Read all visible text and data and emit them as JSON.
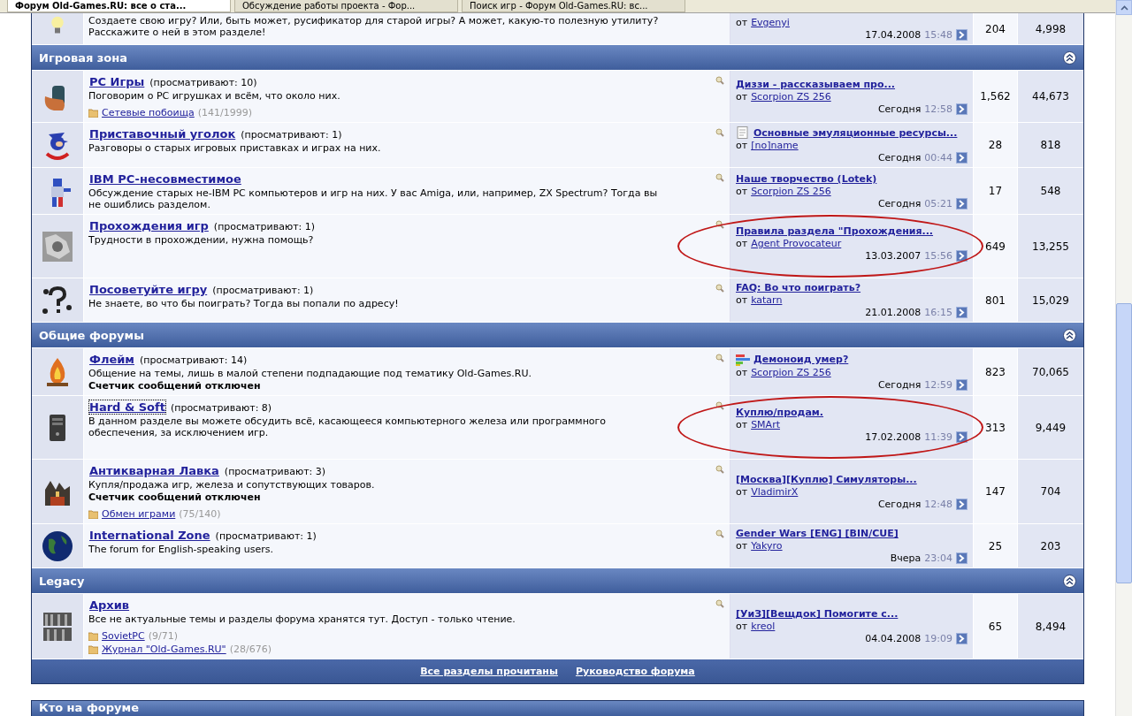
{
  "browser_tabs": [
    {
      "title": "Форум Old-Games.RU: все о ста...",
      "selected": true
    },
    {
      "title": "Обсуждение работы проекта - Фор...",
      "selected": false
    },
    {
      "title": "Поиск игр - Форум Old-Games.RU: вс...",
      "selected": false
    }
  ],
  "partial_row": {
    "description": "Создаете свою игру? Или, быть может, русификатор для старой игры? А может, какую-то полезную утилиту? Расскажите о ней в этом разделе!",
    "last_post": {
      "by": "от",
      "author": "Evgenyi",
      "date": "17.04.2008",
      "time": "15:48"
    },
    "threads": "204",
    "posts": "4,998"
  },
  "categories": [
    {
      "title": "Игровая зона",
      "expanded": true,
      "forums": [
        {
          "title": "PC Игры",
          "viewers": "(просматривают: 10)",
          "focused": false,
          "circled": false,
          "description": "Поговорим о PC игрушках и всём, что около них.",
          "subforums": [
            {
              "name": "Сетевые побоища",
              "count": "(141/1999)"
            }
          ],
          "last_post": {
            "title": "Диззи - рассказываем про...",
            "by": "от",
            "author": "Scorpion ZS 256",
            "date": "Сегодня",
            "time": "12:58"
          },
          "threads": "1,562",
          "posts": "44,673"
        },
        {
          "title": "Приставочный уголок",
          "viewers": "(просматривают: 1)",
          "focused": false,
          "circled": false,
          "description": "Разговоры о старых игровых приставках и играх на них.",
          "last_post": {
            "kind": "document",
            "title": "Основные эмуляционные ресурсы...",
            "by": "от",
            "author": "[no]name",
            "date": "Сегодня",
            "time": "00:44"
          },
          "threads": "28",
          "posts": "818"
        },
        {
          "title": "IBM PC-несовместимое",
          "focused": false,
          "circled": false,
          "description": "Обсуждение старых не-IBM PC компьютеров и игр на них. У вас Amiga, или, например, ZX Spectrum? Тогда вы не ошиблись разделом.",
          "last_post": {
            "title": "Наше творчество (Lotek)",
            "by": "от",
            "author": "Scorpion ZS 256",
            "date": "Сегодня",
            "time": "05:21"
          },
          "threads": "17",
          "posts": "548"
        },
        {
          "title": "Прохождения игр",
          "viewers": "(просматривают: 1)",
          "focused": false,
          "circled": true,
          "description": "Трудности в прохождении, нужна помощь?",
          "last_post": {
            "title": "Правила раздела \"Прохождения...",
            "by": "от",
            "author": "Agent Provocateur",
            "date": "13.03.2007",
            "time": "15:56"
          },
          "threads": "649",
          "posts": "13,255"
        },
        {
          "title": "Посоветуйте игру",
          "viewers": "(просматривают: 1)",
          "focused": false,
          "circled": false,
          "description": "Не знаете, во что бы поиграть? Тогда вы попали по адресу!",
          "last_post": {
            "title": "FAQ: Во что поиграть?",
            "by": "от",
            "author": "katarn",
            "date": "21.01.2008",
            "time": "16:15"
          },
          "threads": "801",
          "posts": "15,029"
        }
      ]
    },
    {
      "title": "Общие форумы",
      "expanded": true,
      "forums": [
        {
          "title": "Флейм",
          "viewers": "(просматривают: 14)",
          "focused": false,
          "circled": false,
          "description": "Общение на темы, лишь в малой степени подпадающие под тематику Old-Games.RU.",
          "note": "Счетчик сообщений отключен",
          "last_post": {
            "kind": "bars",
            "title": "Демоноид умер?",
            "by": "от",
            "author": "Scorpion ZS 256",
            "date": "Сегодня",
            "time": "12:59"
          },
          "threads": "823",
          "posts": "70,065"
        },
        {
          "title": "Hard & Soft",
          "viewers": "(просматривают: 8)",
          "focused": true,
          "circled": true,
          "description": "В данном разделе вы можете обсудить всё, касающееся компьютерного железа или программного обеспечения, за исключением игр.",
          "last_post": {
            "title": "Куплю/продам.",
            "by": "от",
            "author": "SMArt",
            "date": "17.02.2008",
            "time": "11:39"
          },
          "threads": "313",
          "posts": "9,449"
        },
        {
          "title": "Антикварная Лавка",
          "viewers": "(просматривают: 3)",
          "focused": false,
          "circled": false,
          "description": "Купля/продажа игр, железа и сопутствующих товаров.",
          "note": "Счетчик сообщений отключен",
          "subforums": [
            {
              "name": "Обмен играми",
              "count": "(75/140)"
            }
          ],
          "last_post": {
            "title": "[Москва][Куплю] Симуляторы...",
            "by": "от",
            "author": "VladimirX",
            "date": "Сегодня",
            "time": "12:48"
          },
          "threads": "147",
          "posts": "704"
        },
        {
          "title": "International Zone",
          "viewers": "(просматривают: 1)",
          "focused": false,
          "circled": false,
          "description": "The forum for English-speaking users.",
          "last_post": {
            "title": "Gender Wars [ENG] [BIN/CUE]",
            "by": "от",
            "author": "Yakyro",
            "date": "Вчера",
            "time": "23:04"
          },
          "threads": "25",
          "posts": "203"
        }
      ]
    },
    {
      "title": "Legacy",
      "expanded": true,
      "forums": [
        {
          "title": "Архив",
          "focused": false,
          "circled": false,
          "description": "Все не актуальные темы и разделы форума хранятся тут. Доступ - только чтение.",
          "subforums": [
            {
              "name": "SovietPC",
              "count": "(9/71)"
            },
            {
              "name": "Журнал \"Old-Games.RU\"",
              "count": "(28/676)"
            }
          ],
          "last_post": {
            "title": "[УиЗ][Вещдок] Помогите с...",
            "by": "от",
            "author": "kreol",
            "date": "04.04.2008",
            "time": "19:09"
          },
          "threads": "65",
          "posts": "8,494"
        }
      ]
    }
  ],
  "footer_links": [
    "Все разделы прочитаны",
    "Руководство форума"
  ],
  "next_section": {
    "title": "Кто на форуме"
  }
}
